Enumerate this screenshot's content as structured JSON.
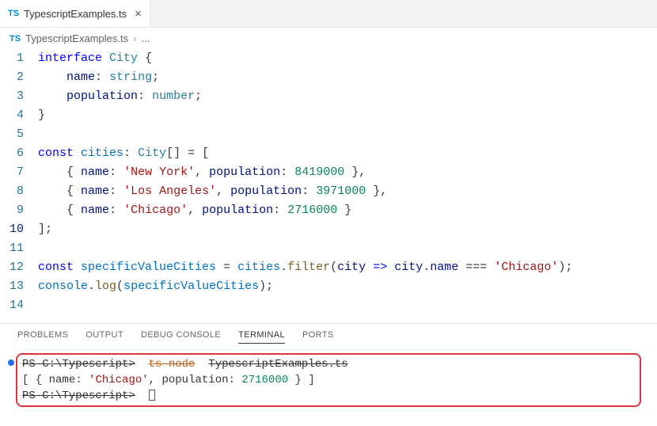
{
  "tab": {
    "icon_label": "TS",
    "filename": "TypescriptExamples.ts"
  },
  "breadcrumb": {
    "icon_label": "TS",
    "filename": "TypescriptExamples.ts",
    "sep": "›",
    "more": "..."
  },
  "editor": {
    "active_line": 10,
    "lines": [
      {
        "n": 1,
        "html": "<span class='tok-kw'>interface</span> <span class='tok-decl'>City</span> <span class='tok-punc'>{</span>"
      },
      {
        "n": 2,
        "html": "    <span class='tok-prop'>name</span><span class='tok-punc'>:</span> <span class='tok-type'>string</span><span class='tok-punc'>;</span>"
      },
      {
        "n": 3,
        "html": "    <span class='tok-prop'>population</span><span class='tok-punc'>:</span> <span class='tok-type'>number</span><span class='tok-punc'>;</span>"
      },
      {
        "n": 4,
        "html": "<span class='tok-punc'>}</span>"
      },
      {
        "n": 5,
        "html": ""
      },
      {
        "n": 6,
        "html": "<span class='tok-kw'>const</span> <span class='tok-var'>cities</span><span class='tok-punc'>:</span> <span class='tok-decl'>City</span><span class='tok-punc'>[] = [</span>"
      },
      {
        "n": 7,
        "html": "    <span class='tok-punc'>{</span> <span class='tok-prop'>name</span><span class='tok-punc'>:</span> <span class='tok-str'>'New York'</span><span class='tok-punc'>,</span> <span class='tok-prop'>population</span><span class='tok-punc'>:</span> <span class='tok-num'>8419000</span> <span class='tok-punc'>},</span>"
      },
      {
        "n": 8,
        "html": "    <span class='tok-punc'>{</span> <span class='tok-prop'>name</span><span class='tok-punc'>:</span> <span class='tok-str'>'Los Angeles'</span><span class='tok-punc'>,</span> <span class='tok-prop'>population</span><span class='tok-punc'>:</span> <span class='tok-num'>3971000</span> <span class='tok-punc'>},</span>"
      },
      {
        "n": 9,
        "html": "    <span class='tok-punc'>{</span> <span class='tok-prop'>name</span><span class='tok-punc'>:</span> <span class='tok-str'>'Chicago'</span><span class='tok-punc'>,</span> <span class='tok-prop'>population</span><span class='tok-punc'>:</span> <span class='tok-num'>2716000</span> <span class='tok-punc'>}</span>"
      },
      {
        "n": 10,
        "html": "<span class='tok-punc'>];</span>"
      },
      {
        "n": 11,
        "html": ""
      },
      {
        "n": 12,
        "html": "<span class='tok-kw'>const</span> <span class='tok-var'>specificValueCities</span> <span class='tok-punc'>=</span> <span class='tok-var'>cities</span><span class='tok-punc'>.</span><span class='tok-fn'>filter</span><span class='tok-punc'>(</span><span class='tok-prop'>city</span> <span class='tok-kw'>=&gt;</span> <span class='tok-prop'>city</span><span class='tok-punc'>.</span><span class='tok-prop'>name</span> <span class='tok-punc'>===</span> <span class='tok-str'>'Chicago'</span><span class='tok-punc'>);</span>"
      },
      {
        "n": 13,
        "html": "<span class='tok-var'>console</span><span class='tok-punc'>.</span><span class='tok-fn'>log</span><span class='tok-punc'>(</span><span class='tok-var'>specificValueCities</span><span class='tok-punc'>);</span>"
      },
      {
        "n": 14,
        "html": ""
      }
    ]
  },
  "panel": {
    "tabs": [
      "PROBLEMS",
      "OUTPUT",
      "DEBUG CONSOLE",
      "TERMINAL",
      "PORTS"
    ],
    "active": "TERMINAL"
  },
  "terminal": {
    "line1_prompt": "PS C:\\Typescript>",
    "line1_cmd": "ts-node",
    "line1_arg": "TypescriptExamples.ts",
    "line2": "[ { name: 'Chicago', population: 2716000 } ]",
    "line2_html": "<span class='tok-punc'>[ {</span> name<span class='tok-punc'>:</span> <span class='term-str'>'Chicago'</span><span class='tok-punc'>,</span> population<span class='tok-punc'>:</span> <span class='term-num'>2716000</span> <span class='tok-punc'>} ]</span>",
    "line3_prompt": "PS C:\\Typescript>"
  }
}
